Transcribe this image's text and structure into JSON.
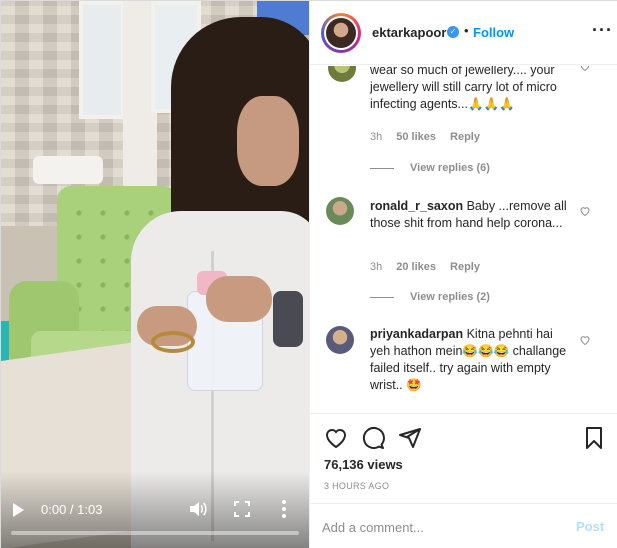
{
  "video": {
    "time_display": "0:00 / 1:03",
    "progress": 0
  },
  "header": {
    "username": "ektarkapoor",
    "verified_glyph": "✓",
    "separator": "•",
    "follow_label": "Follow",
    "more_glyph": "···"
  },
  "comments": [
    {
      "text": "wear so much of jewellery.... your jewellery will still carry lot of micro infecting agents...🙏🙏🙏",
      "time": "3h",
      "likes": "50 likes",
      "reply_label": "Reply",
      "view_replies": "View replies (6)"
    },
    {
      "user": "ronald_r_saxon",
      "text": "Baby ...remove all those shit from hand help corona...",
      "time": "3h",
      "likes": "20 likes",
      "reply_label": "Reply",
      "view_replies": "View replies (2)"
    },
    {
      "user": "priyankadarpan",
      "text": "Kitna pehnti hai yeh hathon mein😂😂😂 challange failed itself.. try again with empty wrist.. 🤩"
    }
  ],
  "actions": {
    "icons": [
      "heart-icon",
      "comment-icon",
      "share-icon",
      "bookmark-icon"
    ],
    "views": "76,136 views",
    "time_ago": "3 HOURS AGO"
  },
  "add_comment": {
    "placeholder": "Add a comment...",
    "post_label": "Post"
  },
  "colors": {
    "link_blue": "#0095f6",
    "post_disabled": "#b2dffc",
    "meta_gray": "#8e8e8e"
  }
}
